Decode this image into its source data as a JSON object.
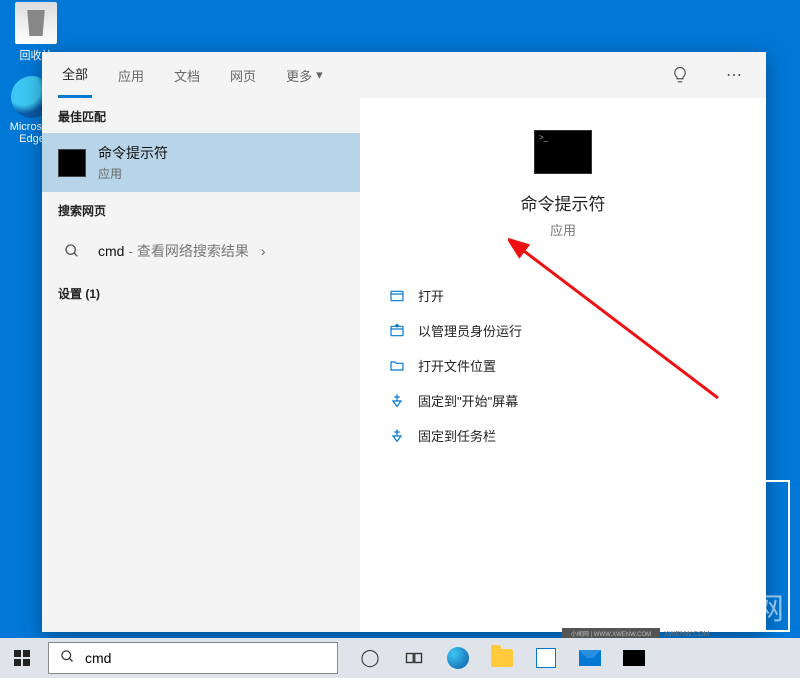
{
  "desktop": {
    "recycle_bin": "回收站",
    "edge": "Microsoft Edge"
  },
  "tabs": {
    "all": "全部",
    "apps": "应用",
    "docs": "文档",
    "web": "网页",
    "more": "更多"
  },
  "sections": {
    "best_match": "最佳匹配",
    "search_web": "搜索网页",
    "settings": "设置 (1)"
  },
  "best_match_item": {
    "title": "命令提示符",
    "sub": "应用"
  },
  "web_item": {
    "query": "cmd",
    "suffix": " - 查看网络搜索结果"
  },
  "detail": {
    "title": "命令提示符",
    "sub": "应用"
  },
  "actions": {
    "open": "打开",
    "run_admin": "以管理员身份运行",
    "open_location": "打开文件位置",
    "pin_start": "固定到\"开始\"屏幕",
    "pin_taskbar": "固定到任务栏"
  },
  "search": {
    "value": "cmd"
  },
  "watermark": "小闻网",
  "credit": "XWENW.COM"
}
